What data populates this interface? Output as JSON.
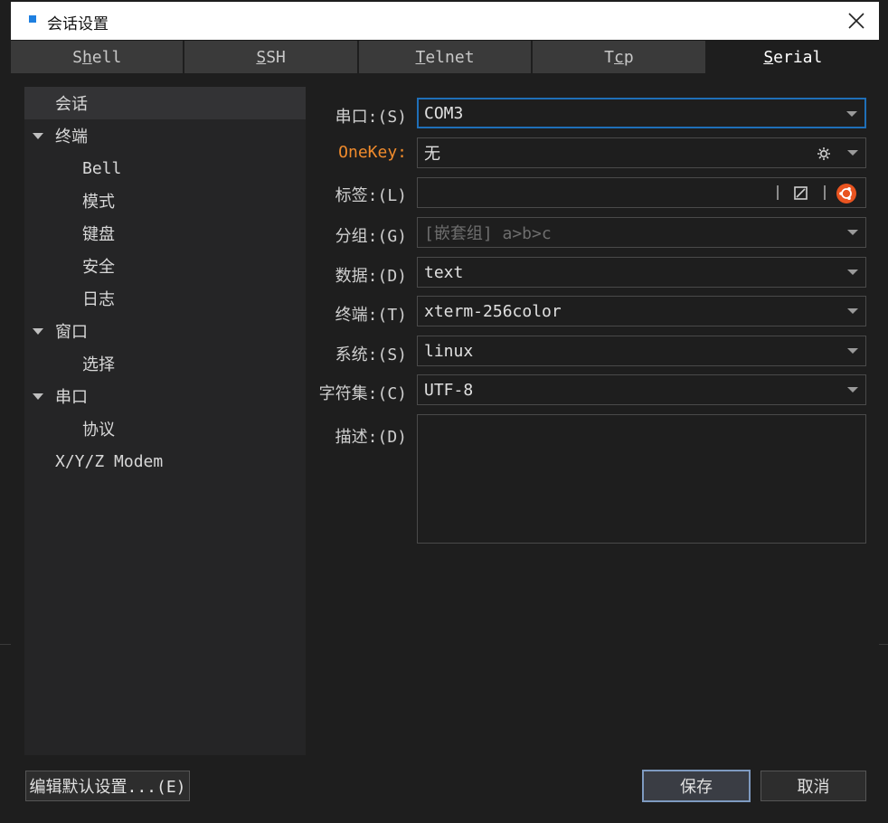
{
  "window": {
    "title": "会话设置",
    "close_label": "Close"
  },
  "tabs": [
    {
      "label_pre": "S",
      "label_u": "h",
      "label_post": "ell"
    },
    {
      "label_pre": "",
      "label_u": "S",
      "label_post": "SH"
    },
    {
      "label_pre": "",
      "label_u": "T",
      "label_post": "elnet"
    },
    {
      "label_pre": "T",
      "label_u": "c",
      "label_post": "p"
    },
    {
      "label_pre": "",
      "label_u": "S",
      "label_post": "erial"
    }
  ],
  "tree": [
    {
      "label": "会话"
    },
    {
      "label": "终端"
    },
    {
      "label": "Bell"
    },
    {
      "label": "模式"
    },
    {
      "label": "键盘"
    },
    {
      "label": "安全"
    },
    {
      "label": "日志"
    },
    {
      "label": "窗口"
    },
    {
      "label": "选择"
    },
    {
      "label": "串口"
    },
    {
      "label": "协议"
    },
    {
      "label": "X/Y/Z Modem"
    }
  ],
  "form": {
    "port": {
      "label": "串口:(S)",
      "value": "COM3"
    },
    "onekey": {
      "label": "OneKey:",
      "value": "无"
    },
    "tag": {
      "label": "标签:(L)",
      "value": ""
    },
    "group": {
      "label": "分组:(G)",
      "placeholder": "[嵌套组] a>b>c"
    },
    "data": {
      "label": "数据:(D)",
      "value": "text"
    },
    "terminal": {
      "label": "终端:(T)",
      "value": "xterm-256color"
    },
    "system": {
      "label": "系统:(S)",
      "value": "linux"
    },
    "charset": {
      "label": "字符集:(C)",
      "value": "UTF-8"
    },
    "description": {
      "label": "描述:(D)",
      "value": ""
    }
  },
  "buttons": {
    "edit_defaults": "编辑默认设置...(E)",
    "save": "保存",
    "cancel": "取消"
  },
  "colors": {
    "accent": "#1f6fb8",
    "onekey_label": "#f08b2c",
    "ubuntu_icon": "#e95420"
  }
}
